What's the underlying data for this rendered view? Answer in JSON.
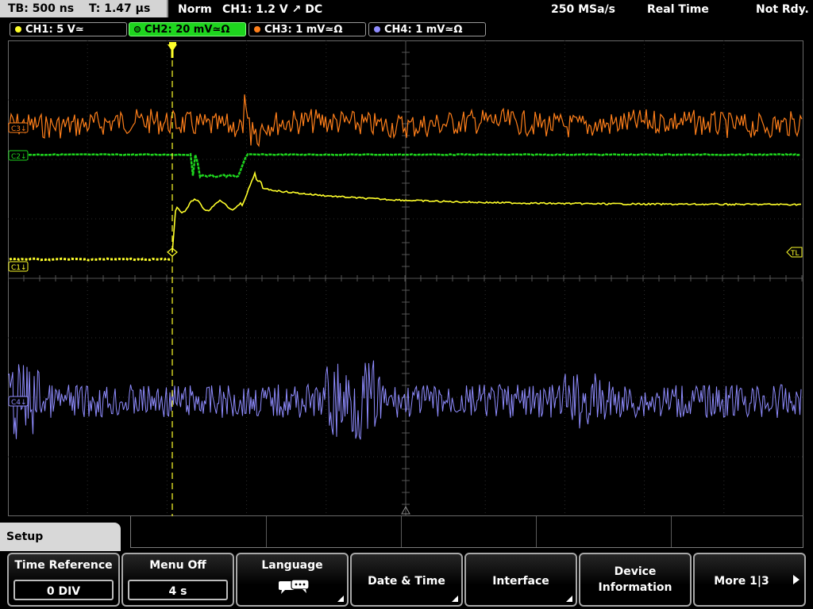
{
  "header": {
    "timebase": "TB: 500 ns",
    "trigger_time": "T: 1.47 µs",
    "trigger_mode": "Norm",
    "trigger_source": "CH1: 1.2 V ↗ DC",
    "sample_rate": "250 MSa/s",
    "acq_mode": "Real Time",
    "status": "Not Rdy."
  },
  "channels": [
    {
      "label": "CH1: 5 V≃",
      "color": "#ffff2a",
      "active": false
    },
    {
      "label": "CH2: 20 mV≃Ω",
      "color": "#1ed51e",
      "active": true
    },
    {
      "label": "CH3: 1 mV≃Ω",
      "color": "#ff7f1a",
      "active": false
    },
    {
      "label": "CH4: 1 mV≃Ω",
      "color": "#8f8cff",
      "active": false
    }
  ],
  "markers": {
    "c3": "C3↓",
    "c2": "C2↓",
    "c1": "C1↓",
    "c4": "C4↓",
    "trigger_level": "TL"
  },
  "menu": {
    "title": "Setup",
    "time_reference_label": "Time Reference",
    "time_reference_value": "0 DIV",
    "menu_off_label": "Menu Off",
    "menu_off_value": "4 s",
    "language_label": "Language",
    "date_time_label": "Date & Time",
    "interface_label": "Interface",
    "device_info_label": "Device Information",
    "more_label": "More 1|3"
  },
  "colors": {
    "ch1": "#ffff2a",
    "ch2": "#1ed51e",
    "ch3": "#ff7f1a",
    "ch4": "#8f8cff",
    "grid": "#3a3a3a",
    "trigger": "#ffff2a"
  }
}
